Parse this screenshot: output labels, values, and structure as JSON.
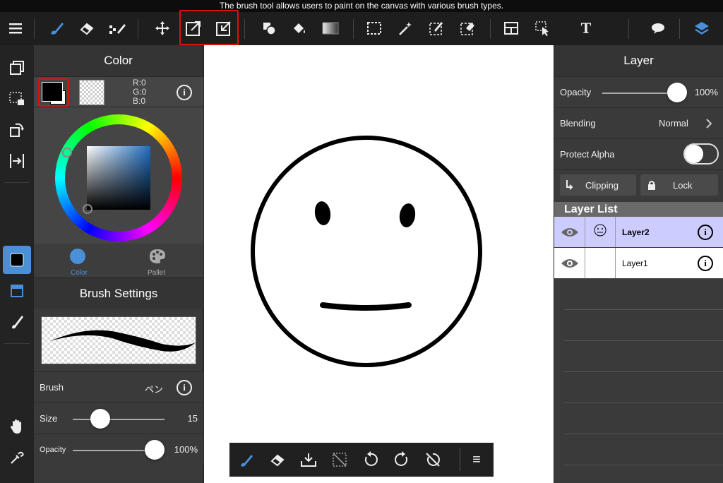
{
  "tooltip": "The brush tool allows users to paint on the canvas with various brush types.",
  "toolbar": {
    "icons": [
      "menu-icon",
      "brush-icon",
      "eraser-icon",
      "blur-icon",
      "move-icon",
      "import-icon",
      "export-icon",
      "shapes-icon",
      "fill-icon",
      "gradient-icon",
      "select-rect-icon",
      "magic-wand-icon",
      "select-pen-icon",
      "select-eraser-icon",
      "layout-icon",
      "select-arrow-icon",
      "text-icon",
      "speech-bubble-icon",
      "layers-icon"
    ],
    "text_tool_label": "T"
  },
  "color_panel": {
    "title": "Color",
    "r": "R:0",
    "g": "G:0",
    "b": "B:0",
    "primary_color": "#000000",
    "tab_color": "Color",
    "tab_pallet": "Pallet"
  },
  "brush_panel": {
    "title": "Brush Settings",
    "brush_label": "Brush",
    "brush_value": "ペン",
    "size_label": "Size",
    "size_value": "15",
    "opacity_label": "Opacity",
    "opacity_value": "100%"
  },
  "layer_panel": {
    "title": "Layer",
    "opacity_label": "Opacity",
    "opacity_value": "100%",
    "blending_label": "Blending",
    "blending_value": "Normal",
    "protect_alpha_label": "Protect Alpha",
    "clipping_label": "Clipping",
    "lock_label": "Lock",
    "list_title": "Layer List",
    "layers": [
      {
        "name": "Layer2",
        "selected": true
      },
      {
        "name": "Layer1",
        "selected": false
      }
    ]
  },
  "bottom_bar": {
    "menu_label": "≡"
  },
  "colors": {
    "accent": "#4a90d9",
    "highlight": "#e01010",
    "selected_layer": "#ccccff"
  }
}
